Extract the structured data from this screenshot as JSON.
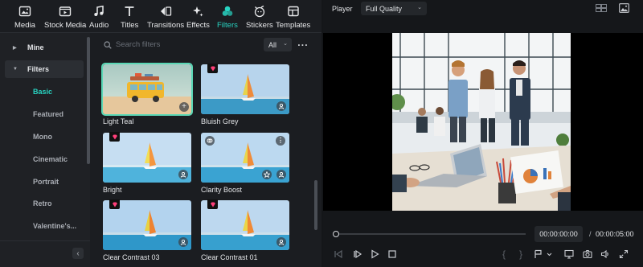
{
  "toolbar": {
    "items": [
      {
        "label": "Media",
        "icon": "media-icon"
      },
      {
        "label": "Stock Media",
        "icon": "stock-media-icon"
      },
      {
        "label": "Audio",
        "icon": "audio-icon"
      },
      {
        "label": "Titles",
        "icon": "titles-icon"
      },
      {
        "label": "Transitions",
        "icon": "transitions-icon"
      },
      {
        "label": "Effects",
        "icon": "effects-icon"
      },
      {
        "label": "Filters",
        "icon": "filters-icon",
        "active": true
      },
      {
        "label": "Stickers",
        "icon": "stickers-icon"
      },
      {
        "label": "Templates",
        "icon": "templates-icon"
      }
    ]
  },
  "sidebar": {
    "categories": [
      {
        "label": "Mine",
        "expanded": false
      },
      {
        "label": "Filters",
        "expanded": true
      }
    ],
    "subcategories": [
      "Basic",
      "Featured",
      "Mono",
      "Cinematic",
      "Portrait",
      "Retro",
      "Valentine's..."
    ],
    "active_subcategory": "Basic"
  },
  "search": {
    "placeholder": "Search filters",
    "scope": "All"
  },
  "filters": [
    {
      "name": "Light Teal",
      "selected": true,
      "premium": false
    },
    {
      "name": "Bluish Grey",
      "premium": true
    },
    {
      "name": "Bright",
      "premium": true
    },
    {
      "name": "Clarity Boost",
      "premium": false
    },
    {
      "name": "Clear Contrast 03",
      "premium": true
    },
    {
      "name": "Clear Contrast 01",
      "premium": true
    }
  ],
  "player": {
    "label": "Player",
    "quality": "Full Quality",
    "current_time": "00:00:00:00",
    "separator": "/",
    "total_time": "00:00:05:00",
    "progress": 0
  },
  "colors": {
    "accent": "#28d4c2",
    "selected_outline": "#5ad7b5",
    "premium_badge": "#ff3f7a"
  }
}
